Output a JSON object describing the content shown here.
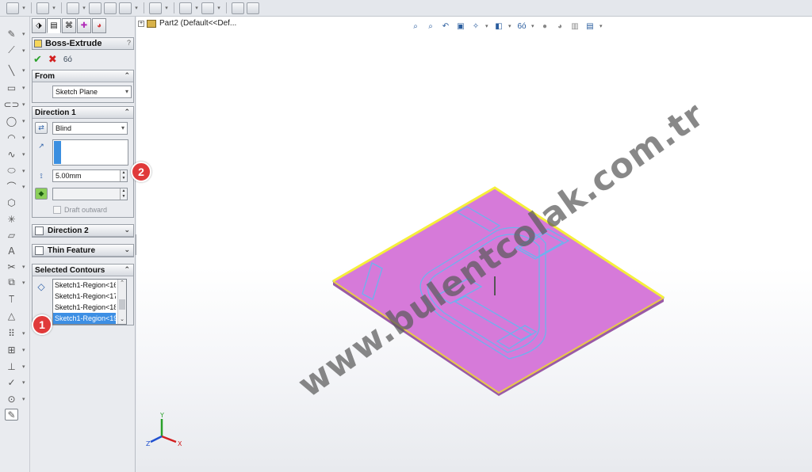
{
  "top_toolbar": {
    "icons": [
      "new-document-icon",
      "save-icon",
      "rebuild-icon",
      "print-icon",
      "undo-icon",
      "options-icon",
      "grid-icon",
      "smart-dimension-icon",
      "sketch-fillet-icon",
      "mirror-icon",
      "move-entities-icon"
    ]
  },
  "left_toolbar": {
    "icons": [
      "sketch-icon",
      "smart-dimension-icon",
      "line-icon",
      "rectangle-icon",
      "slot-icon",
      "circle-icon",
      "arc-icon",
      "spline-icon",
      "ellipse-icon",
      "fillet-icon",
      "polygon-icon",
      "point-icon",
      "plane-icon",
      "text-icon",
      "trim-icon",
      "offset-icon",
      "convert-icon",
      "mirror-icon",
      "linear-pattern-icon",
      "move-icon",
      "relations-icon",
      "repair-icon",
      "quick-snap-icon",
      "rapid-sketch-icon"
    ]
  },
  "property_manager": {
    "tabs": [
      "feature-manager-tab",
      "property-manager-tab",
      "configuration-manager-tab",
      "dimxpert-tab",
      "display-manager-tab"
    ],
    "title": "Boss-Extrude",
    "help": "? ",
    "from": {
      "header": "From",
      "value": "Sketch Plane"
    },
    "direction1": {
      "header": "Direction 1",
      "end_condition": "Blind",
      "depth": "5.00mm",
      "draft_label": "Draft outward"
    },
    "direction2": {
      "header": "Direction 2"
    },
    "thin_feature": {
      "header": "Thin Feature"
    },
    "selected_contours": {
      "header": "Selected Contours",
      "items": [
        "Sketch1-Region<16",
        "Sketch1-Region<17",
        "Sketch1-Region<18",
        "Sketch1-Region<19"
      ]
    }
  },
  "graphics": {
    "tree_root": "Part2  (Default<<Def...",
    "watermark": "www.bulentcolak.com.tr",
    "model_colors": {
      "face": "#d67ad9",
      "edge_top": "#f5ef3a",
      "sketch": "#6db2ee"
    }
  },
  "markers": {
    "m1": "1",
    "m2": "2"
  }
}
